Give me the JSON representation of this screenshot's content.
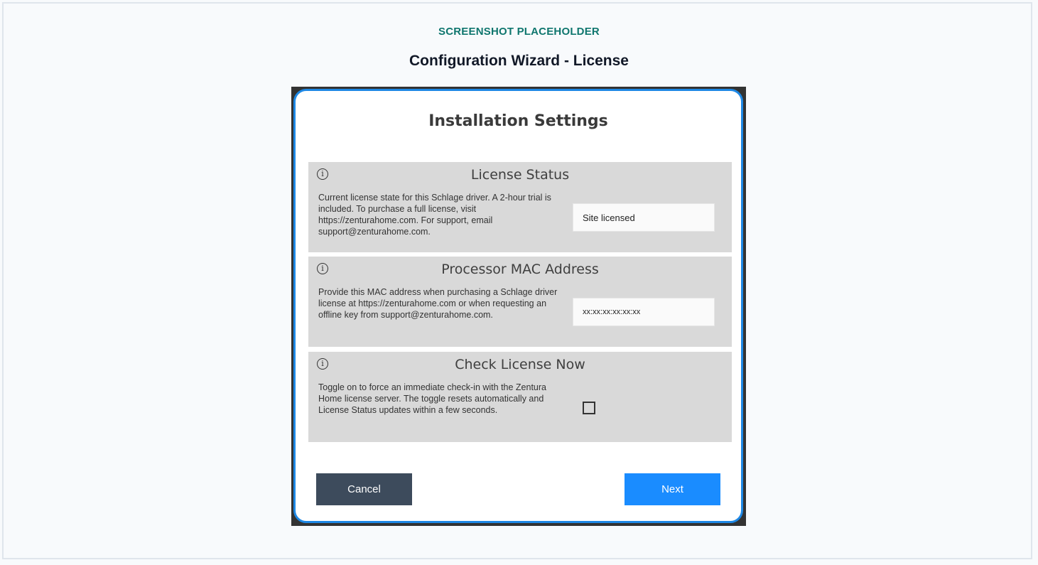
{
  "page": {
    "eyebrow": "SCREENSHOT PLACEHOLDER",
    "caption": "Configuration Wizard - License"
  },
  "dialog": {
    "title": "Installation Settings",
    "sections": [
      {
        "title": "License Status",
        "icon": "info-icon",
        "description": "Current license state for this Schlage driver. A 2-hour trial is included. To purchase a full license, visit https://zenturahome.com. For support, email support@zenturahome.com.",
        "value": "Site licensed"
      },
      {
        "title": "Processor MAC Address",
        "icon": "info-icon",
        "description": "Provide this MAC address when purchasing a Schlage driver license at https://zenturahome.com or when requesting an offline key from support@zenturahome.com.",
        "value": "xx:xx:xx:xx:xx:xx"
      },
      {
        "title": "Check License Now",
        "icon": "info-icon",
        "description": "Toggle on to force an immediate check-in with the Zentura Home license server. The toggle resets automatically and License Status updates within a few seconds.",
        "checked": false
      }
    ],
    "buttons": {
      "cancel": "Cancel",
      "next": "Next"
    }
  },
  "colors": {
    "accent": "#1a8cff",
    "dialog_border": "#1e88e5",
    "cancel_bg": "#3d4b5c",
    "eyebrow": "#0f766e",
    "section_bg": "#d9d9d9"
  }
}
